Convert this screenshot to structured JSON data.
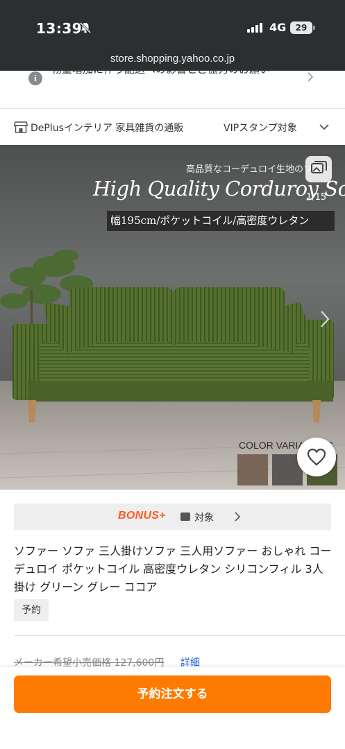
{
  "status_bar": {
    "time": "13:39",
    "network": "4G",
    "battery": "29",
    "url": "store.shopping.yahoo.co.jp"
  },
  "notice": {
    "text": "物量増加に伴う配送への影響とご協力のお願い"
  },
  "store": {
    "name": "DePlusインテリア 家具雑貨の通販",
    "vip": "VIPスタンプ対象"
  },
  "hero": {
    "subtitle": "高品質なコーデュロイ生地のソファ",
    "title": "High Quality Corduroy Sofa",
    "spec": "幅195cm/ポケットコイル/高密度ウレタン",
    "image_count": "1/15",
    "color_label": "COLOR VARIATIONS",
    "swatch_colors": [
      "#7a6658",
      "#5a5757",
      "#4e5a33"
    ]
  },
  "bonus": {
    "logo": "BONUS+",
    "label": "対象"
  },
  "product": {
    "title": "ソファー ソファ 三人掛けソファ 三人用ソファー おしゃれ コーデュロイ ポケットコイル 高密度ウレタン シリコンフィル 3人掛け グリーン グレー ココア",
    "tag": "予約"
  },
  "price": {
    "msrp": "メーカー希望小売価格 127,600円",
    "detail_link": "詳細"
  },
  "cta": {
    "label": "予約注文する"
  },
  "colors": {
    "accent": "#ff7a00",
    "bonus": "#ff5a1f",
    "link": "#1a5fcc",
    "sofa": "#4f6a2c"
  }
}
